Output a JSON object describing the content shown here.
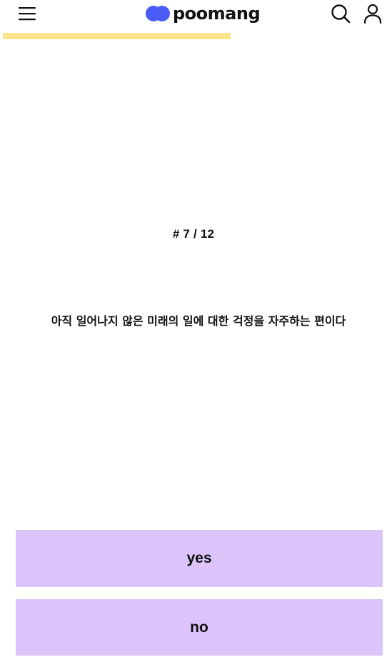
{
  "header": {
    "logo_text": "poomang",
    "menu_icon": "hamburger-menu-icon",
    "search_icon": "search-icon",
    "user_icon": "user-icon"
  },
  "progress": {
    "current": 7,
    "total": 12,
    "fraction": 0.597,
    "color": "#fbe48a"
  },
  "quiz": {
    "counter_label": "# 7 / 12",
    "question": "아직 일어나지 않은 미래의 일에 대한 걱정을 자주하는 편이다"
  },
  "answers": {
    "yes_label": "yes",
    "no_label": "no",
    "button_color": "#dcc4fb"
  },
  "colors": {
    "brand_blue": "#4a5cf5",
    "text": "#111111",
    "background": "#ffffff"
  }
}
